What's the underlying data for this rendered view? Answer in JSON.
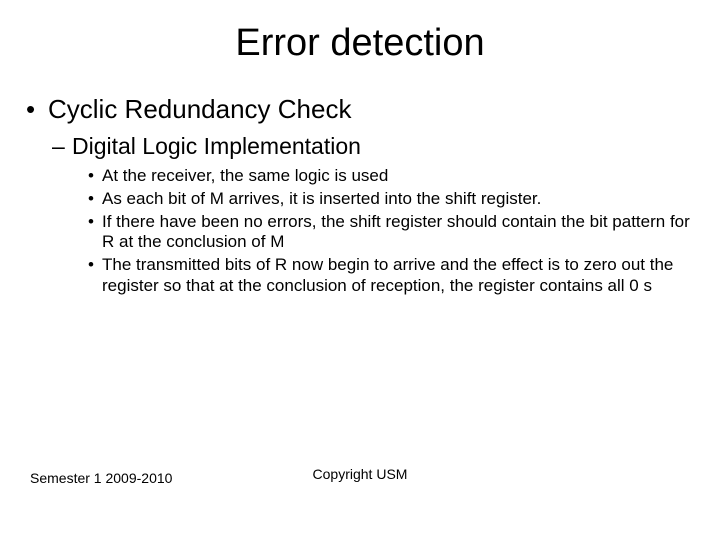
{
  "title": "Error detection",
  "bullets": {
    "l1": "Cyclic Redundancy Check",
    "l2": "Digital Logic Implementation",
    "l3": [
      "At the receiver, the same logic is used",
      "As each bit of M arrives, it is inserted into the shift register.",
      "If there have been no errors, the shift register should contain the bit pattern for R at the conclusion of M",
      "The transmitted bits of R now begin to arrive and the effect is to zero out the register so that at the conclusion of reception, the register contains all 0 s"
    ]
  },
  "footer": {
    "left": "Semester 1 2009-2010",
    "center": "Copyright USM"
  }
}
